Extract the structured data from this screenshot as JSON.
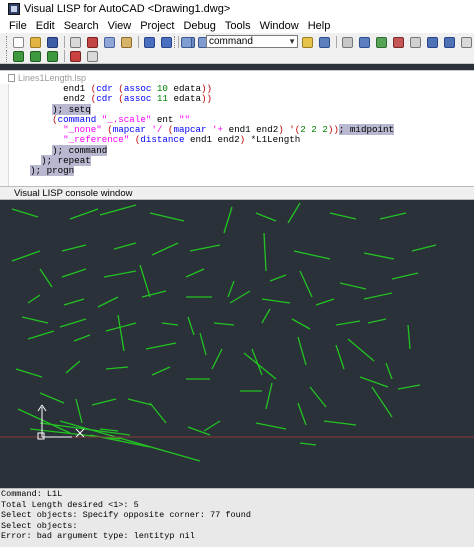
{
  "window": {
    "title": "Visual LISP for AutoCAD <Drawing1.dwg>"
  },
  "menu": [
    "File",
    "Edit",
    "Search",
    "View",
    "Project",
    "Debug",
    "Tools",
    "Window",
    "Help"
  ],
  "toolbar": {
    "command_combo_value": "command"
  },
  "editor": {
    "tab_label": "Lines1Length.lsp",
    "lines": [
      [
        [
          "var",
          "          "
        ],
        [
          "var",
          "end1 "
        ],
        [
          "paren",
          "("
        ],
        [
          "func",
          "cdr "
        ],
        [
          "paren",
          "("
        ],
        [
          "func",
          "assoc "
        ],
        [
          "num",
          "10 "
        ],
        [
          "var",
          "edata"
        ],
        [
          "paren",
          "))"
        ]
      ],
      [
        [
          "var",
          "          "
        ],
        [
          "var",
          "end2 "
        ],
        [
          "paren",
          "("
        ],
        [
          "func",
          "cdr "
        ],
        [
          "paren",
          "("
        ],
        [
          "func",
          "assoc "
        ],
        [
          "num",
          "11 "
        ],
        [
          "var",
          "edata"
        ],
        [
          "paren",
          "))"
        ]
      ],
      [
        [
          "var",
          "        "
        ],
        [
          "hl",
          "); setq"
        ]
      ],
      [
        [
          "var",
          "        "
        ],
        [
          "paren",
          "("
        ],
        [
          "func",
          "command "
        ],
        [
          "str",
          "\"_.scale\" "
        ],
        [
          "var",
          "ent "
        ],
        [
          "str",
          "\"\""
        ]
      ],
      [
        [
          "var",
          "          "
        ],
        [
          "str",
          "\"_none\" "
        ],
        [
          "paren",
          "("
        ],
        [
          "func",
          "mapcar "
        ],
        [
          "str",
          "'/ "
        ],
        [
          "paren",
          "("
        ],
        [
          "func",
          "mapcar "
        ],
        [
          "str",
          "'+ "
        ],
        [
          "var",
          "end1 end2"
        ],
        [
          "paren",
          ") "
        ],
        [
          "paren",
          "'("
        ],
        [
          "num",
          "2 2 2"
        ],
        [
          "paren",
          "))"
        ],
        [
          "hl",
          "; midpoint"
        ]
      ],
      [
        [
          "var",
          "          "
        ],
        [
          "str",
          "\"_reference\" "
        ],
        [
          "paren",
          "("
        ],
        [
          "func",
          "distance "
        ],
        [
          "var",
          "end1 end2"
        ],
        [
          "paren",
          ") "
        ],
        [
          "var",
          "*L1Length"
        ]
      ],
      [
        [
          "var",
          "        "
        ],
        [
          "hl",
          "); command"
        ]
      ],
      [
        [
          "var",
          "      "
        ],
        [
          "hl",
          "); repeat"
        ]
      ],
      [
        [
          "var",
          "    "
        ],
        [
          "hl",
          "); progn"
        ]
      ],
      [
        [
          "var",
          "      "
        ],
        [
          "var",
          ""
        ]
      ]
    ]
  },
  "console": {
    "title": "Visual LISP console window"
  },
  "colors": {
    "drawing_background": "#2b3139",
    "line_color": "#22c322",
    "crosshair_color": "#8a3a3a",
    "ucs_color": "#ffffff"
  },
  "command_history": [
    "Command: L1L",
    "Total Length desired <1>: 5",
    "Select objects: Specify opposite corner: 77 found",
    "Select objects:",
    "Error: bad argument type: lentityp nil"
  ]
}
